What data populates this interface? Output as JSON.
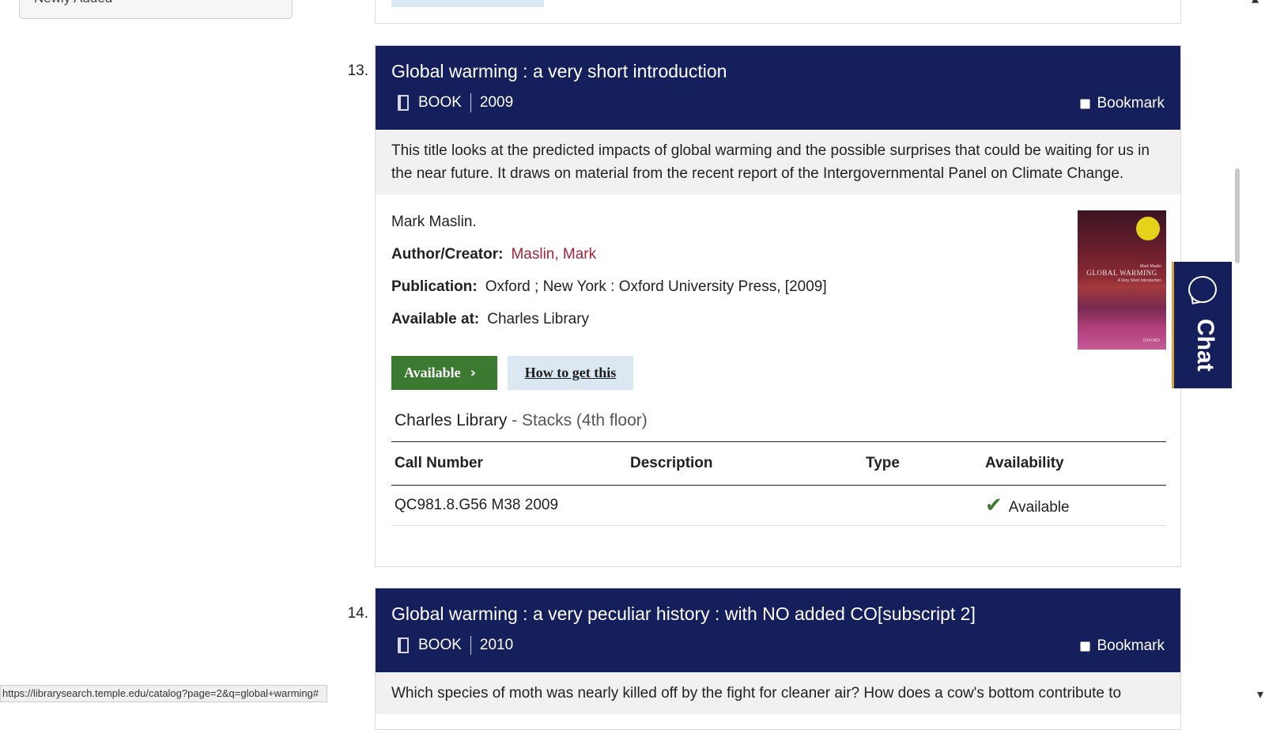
{
  "facet": {
    "label": "Newly Added"
  },
  "results": [
    {
      "number": "13.",
      "title": "Global warming : a very short introduction",
      "format": "BOOK",
      "year": "2009",
      "bookmark_label": "Bookmark",
      "summary": "This title looks at the predicted impacts of global warming and the possible surprises that could be waiting for us in the near future. It draws on material from the recent report of the Intergovernmental Panel on Climate Change.",
      "statement": "Mark Maslin.",
      "author_label": "Author/Creator:",
      "author": "Maslin, Mark",
      "publication_label": "Publication:",
      "publication": "Oxford ; New York : Oxford University Press, [2009]",
      "available_at_label": "Available at:",
      "available_at": "Charles Library",
      "available_button": "Available",
      "howto_button": "How to get this",
      "cover": {
        "title": "GLOBAL WARMING",
        "subtitle": "A Very Short Introduction",
        "author": "Mark Maslin",
        "publisher": "OXFORD"
      },
      "location": "Charles Library",
      "location_detail": " - Stacks (4th floor)",
      "holdings": {
        "headers": [
          "Call Number",
          "Description",
          "Type",
          "Availability"
        ],
        "rows": [
          [
            "QC981.8.G56 M38 2009",
            "",
            "",
            "Available"
          ]
        ]
      }
    },
    {
      "number": "14.",
      "title": "Global warming : a very peculiar history : with NO added CO[subscript 2]",
      "format": "BOOK",
      "year": "2010",
      "bookmark_label": "Bookmark",
      "summary": "Which species of moth was nearly killed off by the fight for cleaner air? How does a cow's bottom contribute to"
    }
  ],
  "chat": {
    "label": "Chat"
  },
  "status_url": "https://librarysearch.temple.edu/catalog?page=2&q=global+warming#"
}
